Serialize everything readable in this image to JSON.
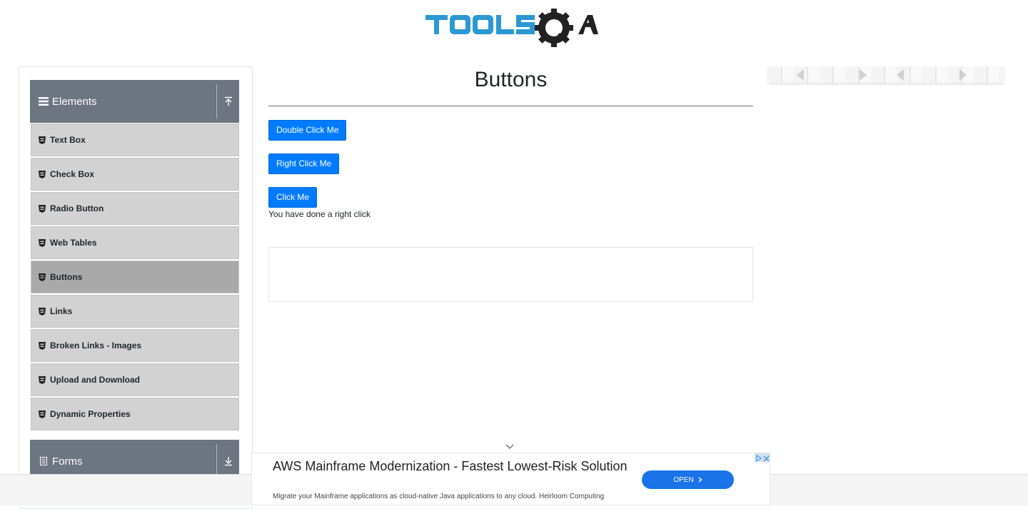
{
  "header": {
    "logo_text": "TOOLSQA",
    "logo_color": "#2c98d3"
  },
  "sidebar": {
    "groups": [
      {
        "label": "Elements",
        "icon": "hamburger-icon",
        "toggle_icon": "arrow-up-icon",
        "expanded": true
      },
      {
        "label": "Forms",
        "icon": "document-icon",
        "toggle_icon": "arrow-down-icon",
        "expanded": false
      }
    ],
    "items": [
      {
        "label": "Text Box",
        "active": false
      },
      {
        "label": "Check Box",
        "active": false
      },
      {
        "label": "Radio Button",
        "active": false
      },
      {
        "label": "Web Tables",
        "active": false
      },
      {
        "label": "Buttons",
        "active": true
      },
      {
        "label": "Links",
        "active": false
      },
      {
        "label": "Broken Links - Images",
        "active": false
      },
      {
        "label": "Upload and Download",
        "active": false
      },
      {
        "label": "Dynamic Properties",
        "active": false
      }
    ],
    "header_color": "#6d7581",
    "item_color": "#d2d2d2",
    "active_item_color": "#a9a9a9"
  },
  "main": {
    "title": "Buttons",
    "buttons": {
      "double_click": "Double Click Me",
      "right_click": "Right Click Me",
      "click": "Click Me"
    },
    "message": "You have done a right click",
    "accent": "#007bff"
  },
  "ad": {
    "title": "AWS Mainframe Modernization - Fastest Lowest-Risk Solution",
    "description": "Migrate your Mainframe applications as cloud-native Java applications to any cloud. Heirloom Computing",
    "cta": "OPEN",
    "cta_color": "#1a73e8"
  }
}
